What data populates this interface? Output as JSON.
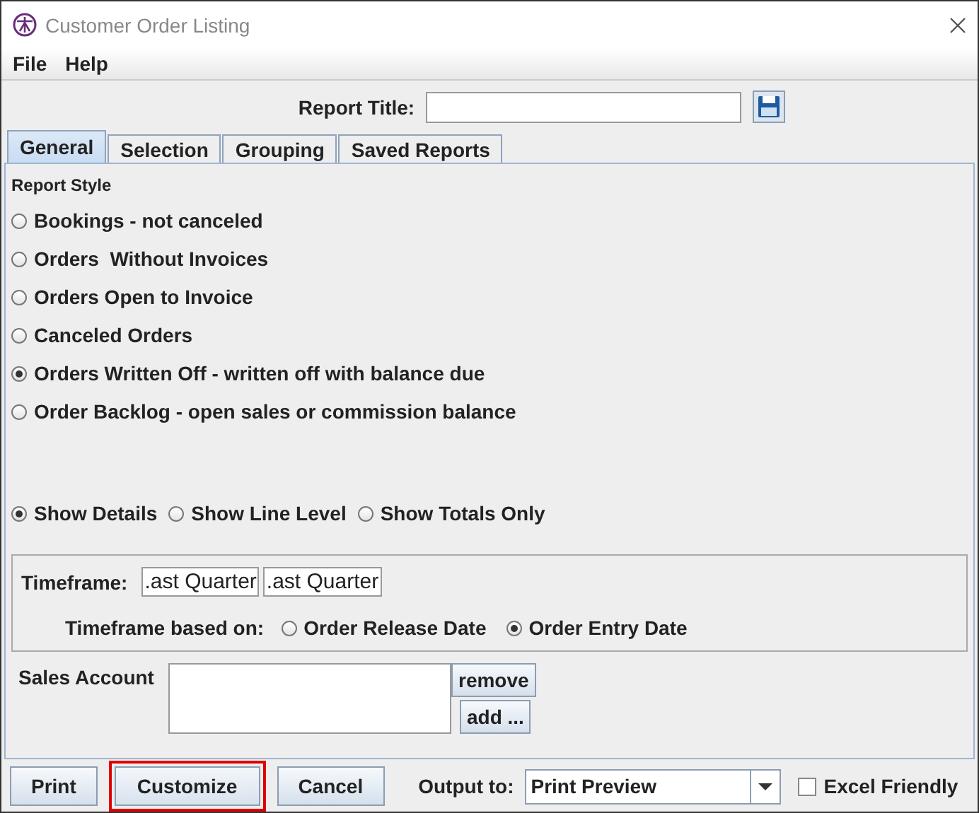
{
  "window": {
    "title": "Customer Order Listing"
  },
  "menu": [
    {
      "label": "File"
    },
    {
      "label": "Help"
    }
  ],
  "report_title": {
    "label": "Report Title:"
  },
  "tabs": [
    {
      "label": "General",
      "selected": true
    },
    {
      "label": "Selection",
      "selected": false
    },
    {
      "label": "Grouping",
      "selected": false
    },
    {
      "label": "Saved Reports",
      "selected": false
    }
  ],
  "report_style": {
    "heading": "Report Style",
    "options": [
      {
        "label": "Bookings - not canceled",
        "selected": false
      },
      {
        "label": "Orders  Without Invoices",
        "selected": false
      },
      {
        "label": "Orders Open to Invoice",
        "selected": false
      },
      {
        "label": "Canceled Orders",
        "selected": false
      },
      {
        "label": "Orders Written Off - written off with balance due",
        "selected": true
      },
      {
        "label": "Order Backlog - open sales or commission balance",
        "selected": false
      }
    ]
  },
  "detail_options": [
    {
      "label": "Show Details",
      "selected": true
    },
    {
      "label": "Show Line Level",
      "selected": false
    },
    {
      "label": "Show Totals Only",
      "selected": false
    }
  ],
  "timeframe": {
    "label": "Timeframe:",
    "values": [
      ".ast Quarter",
      ".ast Quarter"
    ],
    "based_on_label": "Timeframe based on:",
    "based_on": [
      {
        "label": "Order Release Date",
        "selected": false
      },
      {
        "label": "Order Entry Date",
        "selected": true
      }
    ]
  },
  "sales_account": {
    "label": "Sales Account",
    "buttons": [
      "remove",
      "add ..."
    ]
  },
  "footer": {
    "buttons": [
      {
        "label": "Print",
        "highlighted": false
      },
      {
        "label": "Customize",
        "highlighted": true
      },
      {
        "label": "Cancel",
        "highlighted": false
      }
    ],
    "output_label": "Output to:",
    "output_value": "Print Preview",
    "excel": {
      "label": "Excel Friendly",
      "checked": false
    }
  }
}
